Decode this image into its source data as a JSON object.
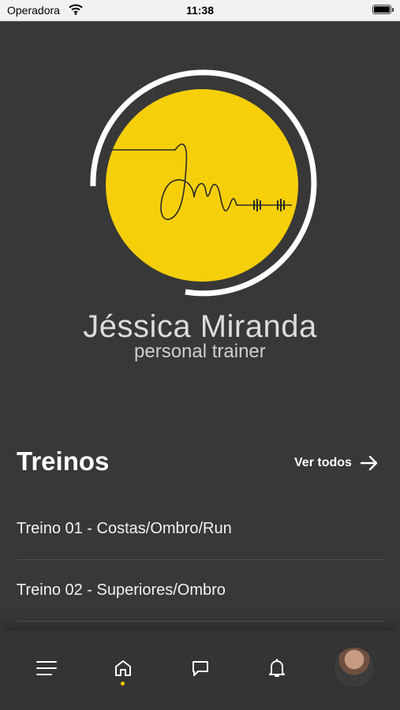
{
  "status_bar": {
    "carrier": "Operadora",
    "time": "11:38"
  },
  "brand": {
    "name": "Jéssica Miranda",
    "subtitle": "personal trainer",
    "accent_color": "#f5cf0a"
  },
  "workouts": {
    "title": "Treinos",
    "see_all": "Ver todos",
    "items": [
      {
        "label": "Treino 01 - Costas/Ombro/Run"
      },
      {
        "label": "Treino 02 - Superiores/Ombro"
      }
    ]
  },
  "tab_bar": {
    "items": [
      {
        "icon": "menu-icon"
      },
      {
        "icon": "home-icon",
        "active": true
      },
      {
        "icon": "chat-icon"
      },
      {
        "icon": "bell-icon"
      },
      {
        "icon": "avatar"
      }
    ]
  }
}
